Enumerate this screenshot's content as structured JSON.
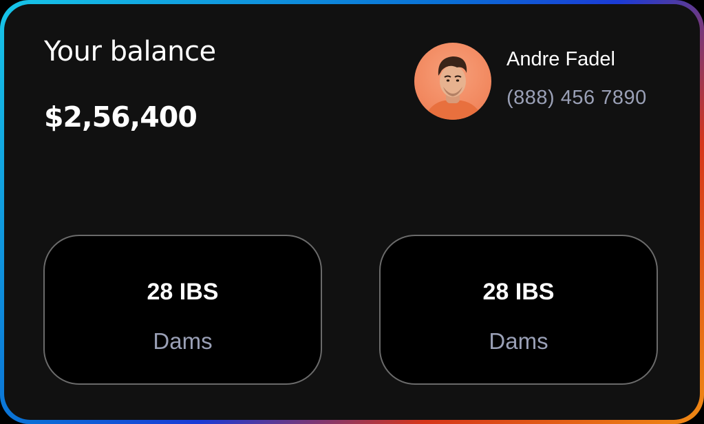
{
  "balance": {
    "title": "Your balance",
    "amount": "$2,56,400"
  },
  "user": {
    "name": "Andre Fadel",
    "phone": "(888) 456 7890",
    "avatar_icon": "user-avatar"
  },
  "stats": [
    {
      "value": "28 IBS",
      "label": "Dams"
    },
    {
      "value": "28 IBS",
      "label": "Dams"
    }
  ],
  "colors": {
    "card_background": "#111111",
    "stat_background": "#000000",
    "muted_text": "#9aa0b6",
    "avatar_background": "#f28a61"
  }
}
